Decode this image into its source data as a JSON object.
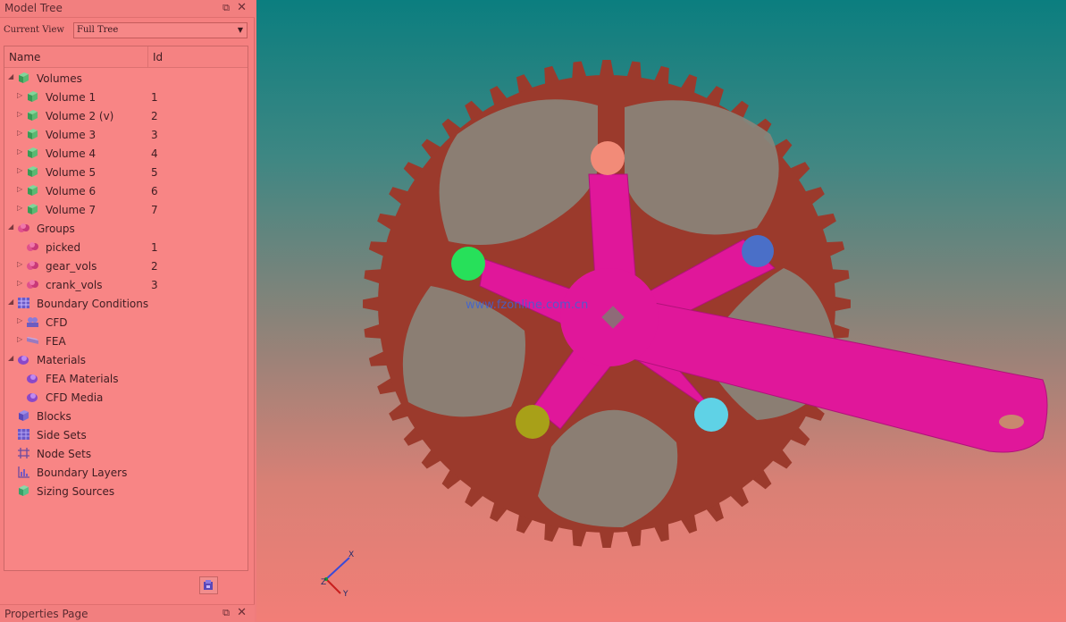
{
  "model_tree": {
    "title": "Model Tree",
    "current_view_label": "Current View",
    "current_view_value": "Full Tree",
    "columns": {
      "name": "Name",
      "id": "Id"
    },
    "volumes": {
      "label": "Volumes",
      "items": [
        {
          "label": "Volume 1",
          "id": "1"
        },
        {
          "label": "Volume 2 (v)",
          "id": "2"
        },
        {
          "label": "Volume 3",
          "id": "3"
        },
        {
          "label": "Volume 4",
          "id": "4"
        },
        {
          "label": "Volume 5",
          "id": "5"
        },
        {
          "label": "Volume 6",
          "id": "6"
        },
        {
          "label": "Volume 7",
          "id": "7"
        }
      ]
    },
    "groups": {
      "label": "Groups",
      "items": [
        {
          "label": "picked",
          "id": "1"
        },
        {
          "label": "gear_vols",
          "id": "2"
        },
        {
          "label": "crank_vols",
          "id": "3"
        }
      ]
    },
    "boundary_conditions": {
      "label": "Boundary Conditions",
      "items": [
        {
          "label": "CFD"
        },
        {
          "label": "FEA"
        }
      ]
    },
    "materials": {
      "label": "Materials",
      "items": [
        {
          "label": "FEA Materials"
        },
        {
          "label": "CFD Media"
        }
      ]
    },
    "blocks": "Blocks",
    "side_sets": "Side Sets",
    "node_sets": "Node Sets",
    "boundary_layers": "Boundary Layers",
    "sizing_sources": "Sizing Sources"
  },
  "properties_page": {
    "title": "Properties Page"
  },
  "viewport": {
    "watermark": "www.fzonline.com.cn",
    "axes": {
      "x": "X",
      "y": "Y",
      "z": "Z"
    },
    "colors": {
      "gear": "#9b3a2c",
      "crank": "#e0179a",
      "hole_top": "#f28b78",
      "hole_left": "#27e05a",
      "hole_right": "#4a6fc8",
      "hole_bottom_left": "#a8a018",
      "hole_bottom_right": "#5fd2e6"
    }
  }
}
